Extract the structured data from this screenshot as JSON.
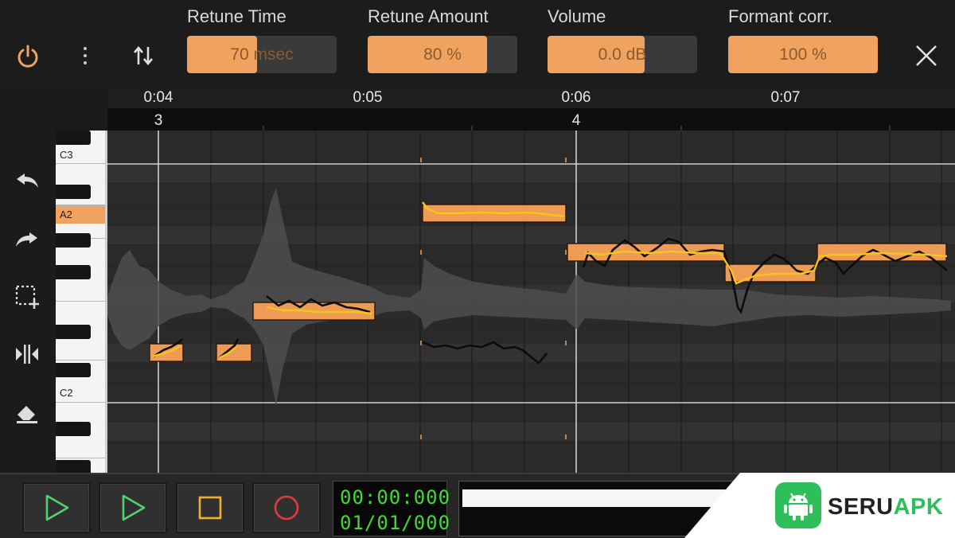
{
  "params": [
    {
      "label": "Retune Time",
      "value": "70 msec",
      "fill": 0.47
    },
    {
      "label": "Retune Amount",
      "value": "80 %",
      "fill": 0.8
    },
    {
      "label": "Volume",
      "value": "0.0 dB",
      "fill": 0.65
    },
    {
      "label": "Formant corr.",
      "value": "100 %",
      "fill": 1.0
    }
  ],
  "timeline": {
    "times": [
      "0:04",
      "0:05",
      "0:06",
      "0:07"
    ],
    "bars": [
      "3",
      "4"
    ]
  },
  "piano": {
    "labels": {
      "c3": "C3",
      "a2": "A2",
      "c2": "C2"
    },
    "active_note": "A2"
  },
  "transport": {
    "time": "00:00:000",
    "position": "01/01/000"
  },
  "watermark": {
    "text_a": "SERU",
    "text_b": "APK"
  },
  "colors": {
    "accent": "#f0a35e",
    "note_fill": "#ee9c55",
    "pitch_line": "#f5c518",
    "counter_text": "#3fdc2d",
    "watermark_green": "#2fbf5a"
  },
  "icons": {
    "power": "power-icon",
    "more": "more-vert-icon",
    "sort": "swap-vert-icon",
    "close": "close-icon",
    "undo": "undo-icon",
    "redo": "redo-icon",
    "select": "select-add-icon",
    "split": "split-icon",
    "erase": "eraser-icon"
  }
}
